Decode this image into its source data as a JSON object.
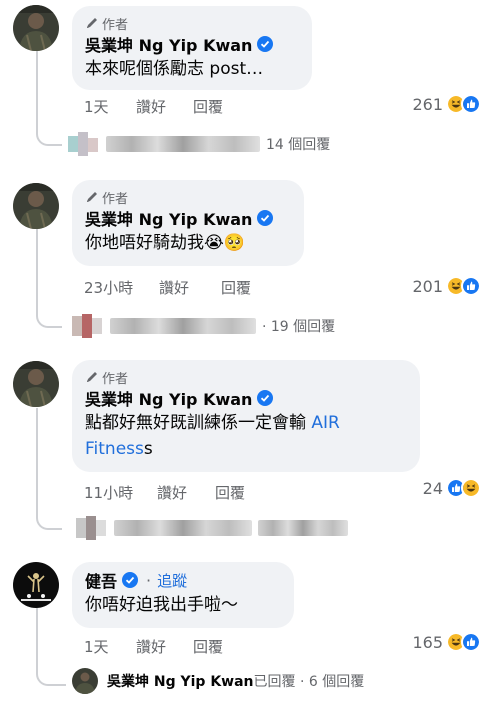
{
  "colors": {
    "bubble": "#f0f2f5",
    "meta": "#65676b",
    "link": "#216fdb",
    "verified": "#1877f2"
  },
  "icons": {
    "author": "pencil-icon",
    "verified": "verified-badge-icon",
    "haha": "haha-reaction-icon",
    "like": "like-reaction-icon"
  },
  "comments": [
    {
      "author_tag": "作者",
      "name": "吳業坤 Ng Yip Kwan",
      "text": "本來呢個係勵志 post…",
      "time": "1天",
      "like_label": "讚好",
      "reply_label": "回覆",
      "reactions": "261",
      "replies": "14 個回覆"
    },
    {
      "author_tag": "作者",
      "name": "吳業坤 Ng Yip Kwan",
      "text": "你地唔好騎劫我😭🥺",
      "time": "23小時",
      "like_label": "讚好",
      "reply_label": "回覆",
      "reactions": "201",
      "replies": "· 19 個回覆"
    },
    {
      "author_tag": "作者",
      "name": "吳業坤 Ng Yip Kwan",
      "text_line1": "點都好無好既訓練係一定會輸 ",
      "link_part1": "AIR",
      "link_part2": "Fitness",
      "text_tail": "s",
      "time": "11小時",
      "like_label": "讚好",
      "reply_label": "回覆",
      "reactions": "24"
    },
    {
      "name": "健吾",
      "follow_sep": "·",
      "follow_label": "追蹤",
      "text": "你唔好迫我出手啦～",
      "time": "1天",
      "like_label": "讚好",
      "reply_label": "回覆",
      "reactions": "165",
      "reply_author": "吳業坤 Ng Yip Kwan",
      "reply_meta": "已回覆 · 6 個回覆"
    }
  ]
}
